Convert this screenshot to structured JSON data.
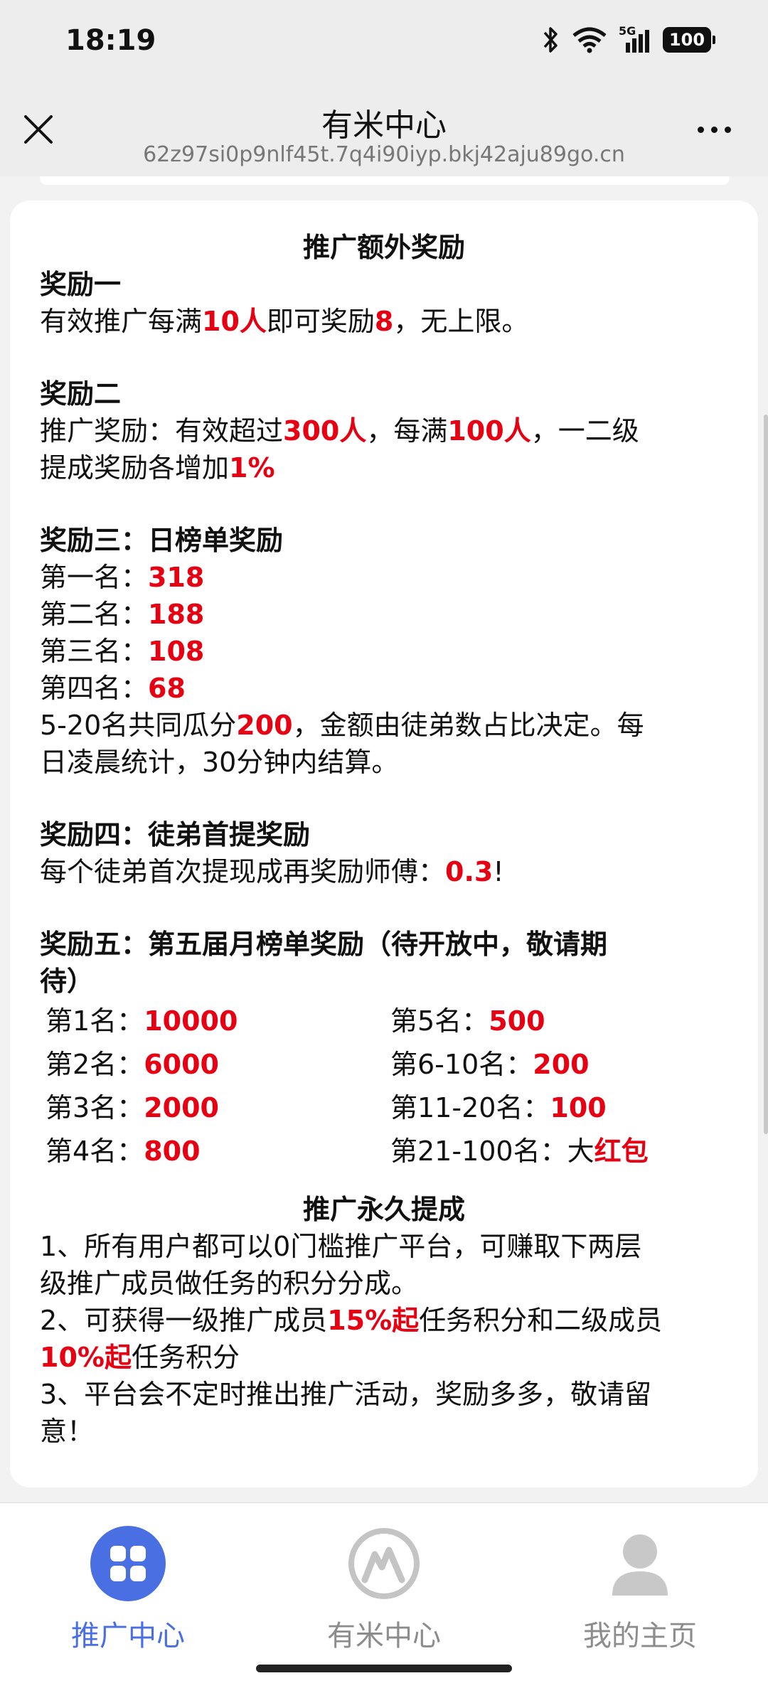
{
  "status_bar": {
    "time": "18:19",
    "battery": "100",
    "network": "5G"
  },
  "nav": {
    "title": "有米中心",
    "url": "62z97si0p9nlf45t.7q4i90iyp.bkj42aju89go.cn"
  },
  "content": {
    "extra_title": "推广额外奖励",
    "r1": {
      "heading": "奖励一",
      "line": [
        "有效推广每满",
        "10人",
        "即可奖励",
        "8",
        "，无上限。"
      ]
    },
    "r2": {
      "heading": "奖励二",
      "line1": [
        "推广奖励：有效超过",
        "300人",
        "，每满",
        "100人",
        "，一二级"
      ],
      "line2": [
        "提成奖励各增加",
        "1%"
      ]
    },
    "r3": {
      "heading": "奖励三：日榜单奖励",
      "ranks": [
        {
          "label": "第一名：",
          "value": "318"
        },
        {
          "label": "第二名：",
          "value": "188"
        },
        {
          "label": "第三名：",
          "value": "108"
        },
        {
          "label": "第四名：",
          "value": "68"
        }
      ],
      "share_line1": [
        "5-20名共同瓜分",
        "200",
        "，金额由徒弟数占比决定。每"
      ],
      "share_line2": "日凌晨统计，30分钟内结算。"
    },
    "r4": {
      "heading": "奖励四：徒弟首提奖励",
      "line": [
        "每个徒弟首次提现成再奖励师傅：",
        "0.3",
        "!"
      ]
    },
    "r5": {
      "heading_line1": "奖励五：第五届月榜单奖励（待开放中，敬请期",
      "heading_line2": "待）",
      "ranks": [
        {
          "label": "第1名：",
          "value": "10000"
        },
        {
          "label": "第5名：",
          "value": "500"
        },
        {
          "label": "第2名：",
          "value": "6000"
        },
        {
          "label": "第6-10名：",
          "value": "200"
        },
        {
          "label": "第3名：",
          "value": "2000"
        },
        {
          "label": "第11-20名：",
          "value": "100"
        },
        {
          "label": "第4名：",
          "value": "800"
        },
        {
          "label": "第21-100名：",
          "prefix": "大",
          "value": "红包"
        }
      ]
    },
    "perm_title": "推广永久提成",
    "perm": {
      "p1a": "1、所有用户都可以0门槛推广平台，可赚取下两层",
      "p1b": "级推广成员做任务的积分分成。",
      "p2a": [
        "2、可获得一级推广成员",
        "15%起",
        "任务积分和二级成员"
      ],
      "p2b": [
        "10%起",
        "任务积分"
      ],
      "p3a": "3、平台会不定时推出推广活动，奖励多多，敬请留",
      "p3b": "意！"
    }
  },
  "tabs": [
    {
      "label": "推广中心",
      "icon": "grid-icon",
      "active": true
    },
    {
      "label": "有米中心",
      "icon": "mountain-logo-icon",
      "active": false
    },
    {
      "label": "我的主页",
      "icon": "user-icon",
      "active": false
    }
  ],
  "colors": {
    "accent": "#e60012",
    "tab_active": "#4a6fe3",
    "tab_inactive": "#8c8c8c"
  }
}
